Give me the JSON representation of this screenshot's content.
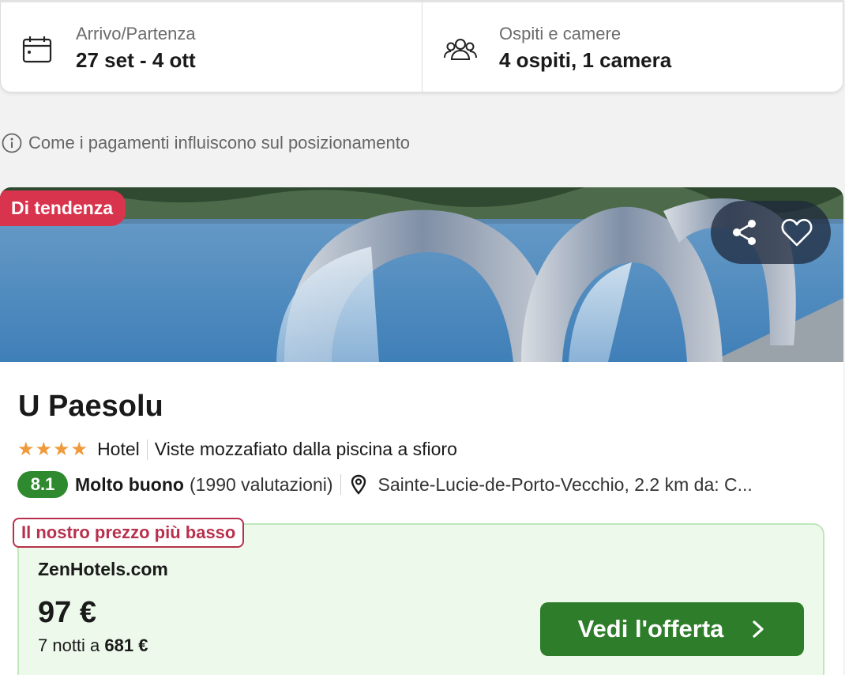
{
  "search": {
    "dates_label": "Arrivo/Partenza",
    "dates_value": "27 set - 4 ott",
    "guests_label": "Ospiti e camere",
    "guests_value": "4 ospiti, 1 camera"
  },
  "payment_note": "Come i pagamenti influiscono sul posizionamento",
  "hotel": {
    "badge": "Di tendenza",
    "name": "U Paesolu",
    "stars": 4,
    "type": "Hotel",
    "highlight": "Viste mozzafiato dalla piscina a sfioro",
    "score": "8.1",
    "rating_word": "Molto buono",
    "rating_count": "(1990 valutazioni)",
    "location": "Sainte-Lucie-de-Porto-Vecchio, 2.2 km da: C..."
  },
  "offer": {
    "best_price_label": "Il nostro prezzo più basso",
    "provider": "ZenHotels.com",
    "price": "97 €",
    "nights_prefix": "7 notti a",
    "nights_total": "681 €",
    "cta_label": "Vedi l'offerta"
  },
  "icons": {
    "calendar": "calendar-icon",
    "guests": "guests-icon",
    "info": "info-icon",
    "share": "share-icon",
    "heart": "heart-icon",
    "pin": "location-pin-icon",
    "star": "star-icon",
    "chevron": "chevron-right-icon"
  },
  "colors": {
    "badge": "#d9344d",
    "score": "#2f8a2f",
    "cta": "#2e7d2a",
    "best_price": "#b8304c",
    "offer_bg": "#edfaeb",
    "star": "#f09a3c"
  }
}
